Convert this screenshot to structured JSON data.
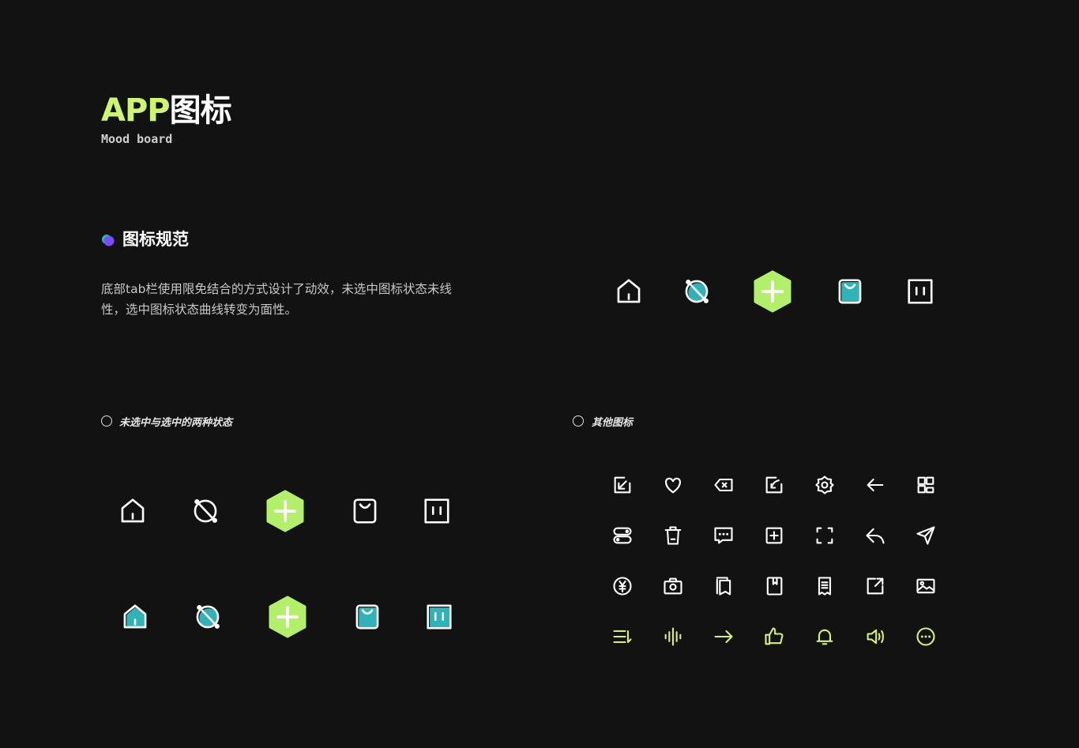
{
  "header": {
    "title_en": "APP",
    "title_cn": "图标",
    "subtitle": "Mood board"
  },
  "section": {
    "title": "图标规范",
    "description": "底部tab栏使用限免结合的方式设计了动效，未选中图标状态未线性，选中图标状态曲线转变为面性。"
  },
  "colors": {
    "background": "#121212",
    "accent_green": "#cdf56e",
    "hex_green": "#b3f06a",
    "teal": "#2fb3b8",
    "lime_icon": "#d5f26b",
    "dot_purple": "#7b4dff",
    "dot_teal": "#1ec0a8"
  },
  "preview_tabbar": [
    "home-outline",
    "planet-teal",
    "plus-hexagon",
    "bag-teal",
    "board-outline"
  ],
  "states": {
    "label": "未选中与选中的两种状态",
    "unselected": [
      "home-outline",
      "planet-outline",
      "plus-hexagon",
      "bag-outline",
      "board-outline"
    ],
    "selected": [
      "home-teal",
      "planet-teal",
      "plus-hexagon",
      "bag-teal",
      "board-teal"
    ]
  },
  "others": {
    "label": "其他图标",
    "rows": [
      [
        "import-icon",
        "heart-icon",
        "backspace-icon",
        "import-curve-icon",
        "settings-icon",
        "arrow-left-icon",
        "grid-icon"
      ],
      [
        "toggle-icon",
        "trash-icon",
        "comment-icon",
        "add-square-icon",
        "scan-icon",
        "reply-icon",
        "send-icon"
      ],
      [
        "yuan-icon",
        "camera-icon",
        "bookmarks-icon",
        "book-icon",
        "receipt-icon",
        "share-icon",
        "image-icon"
      ],
      [
        "sort-icon",
        "voice-icon",
        "arrow-right-icon",
        "thumbs-up-icon",
        "bell-icon",
        "volume-icon",
        "more-icon"
      ]
    ]
  }
}
